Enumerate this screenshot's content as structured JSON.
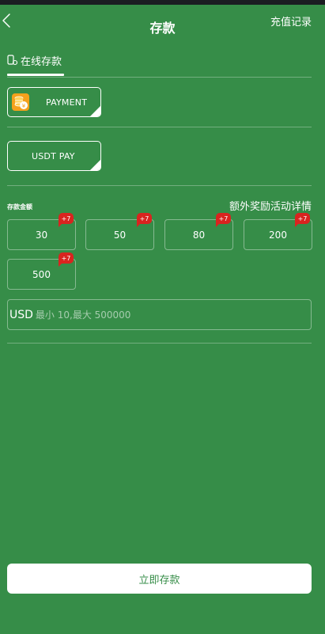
{
  "header": {
    "title": "存款",
    "records_link": "充值记录"
  },
  "tab": {
    "label": "在线存款",
    "icon": "phone-deposit-icon"
  },
  "payment_methods": [
    {
      "label": "PAYMENT",
      "icon": "coin-stack-icon",
      "selected": true
    },
    {
      "label": "USDT PAY",
      "icon": "",
      "selected": true
    }
  ],
  "amount_section": {
    "label": "存款金额",
    "bonus_link": "额外奖励活动详情"
  },
  "amounts": [
    {
      "value": "30",
      "bonus": "+7"
    },
    {
      "value": "50",
      "bonus": "+7"
    },
    {
      "value": "80",
      "bonus": "+7"
    },
    {
      "value": "200",
      "bonus": "+7"
    },
    {
      "value": "500",
      "bonus": "+7"
    }
  ],
  "amount_input": {
    "currency": "USD",
    "placeholder": "最小 10,最大 500000",
    "value": ""
  },
  "submit_label": "立即存款",
  "colors": {
    "background": "#368d48",
    "badge": "#d9241f",
    "coin": "#f4a11c",
    "button_bg": "#ffffff"
  }
}
